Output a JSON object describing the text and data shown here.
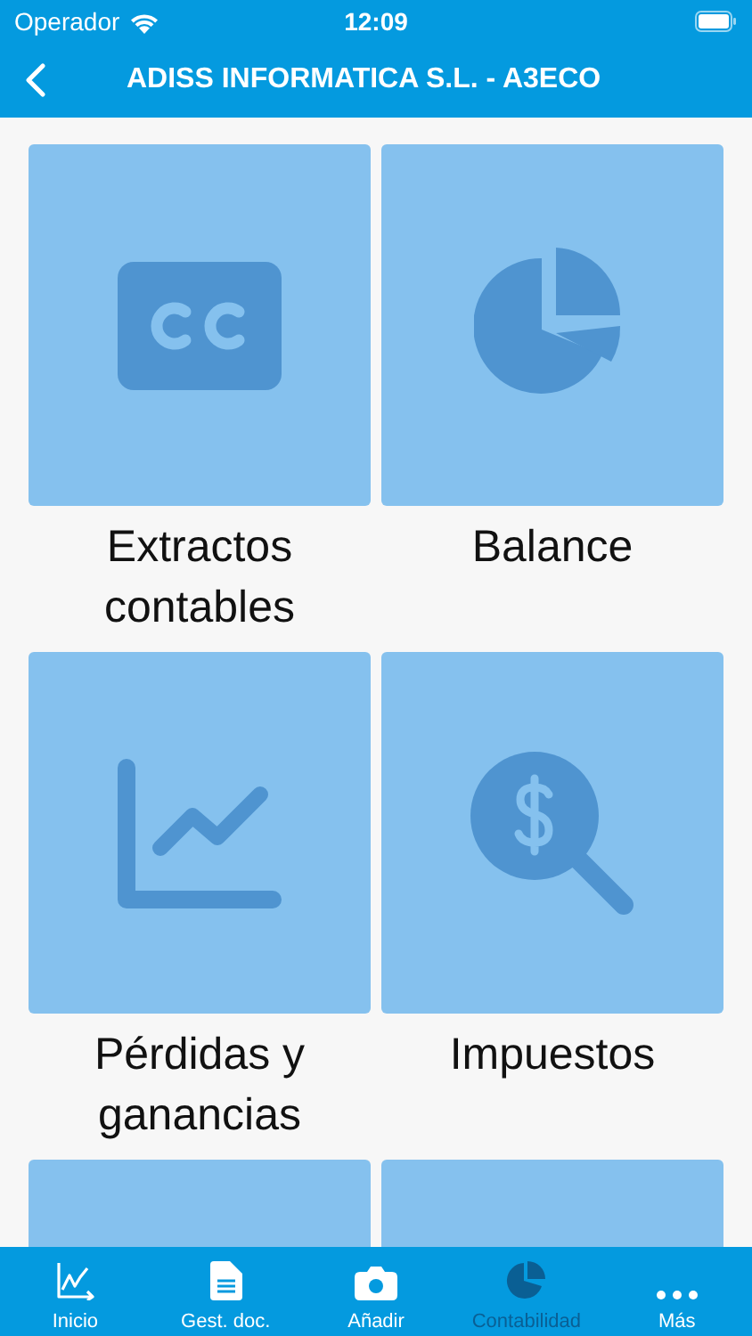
{
  "status_bar": {
    "carrier": "Operador",
    "time": "12:09"
  },
  "nav_bar": {
    "title": "ADISS INFORMATICA S.L. - A3ECO"
  },
  "tiles": [
    {
      "kind": "cc",
      "label": "Extractos contables"
    },
    {
      "kind": "pie",
      "label": "Balance"
    },
    {
      "kind": "chart",
      "label": "Pérdidas y ganancias"
    },
    {
      "kind": "tax",
      "label": "Impuestos"
    },
    {
      "kind": "hidden"
    },
    {
      "kind": "hidden"
    }
  ],
  "tab_bar": [
    {
      "kind": "chart",
      "label": "Inicio",
      "selected": false
    },
    {
      "kind": "doc",
      "label": "Gest. doc.",
      "selected": false
    },
    {
      "kind": "camera",
      "label": "Añadir",
      "selected": false
    },
    {
      "kind": "pie",
      "label": "Contabilidad",
      "selected": true
    },
    {
      "kind": "more",
      "label": "Más",
      "selected": false
    }
  ]
}
